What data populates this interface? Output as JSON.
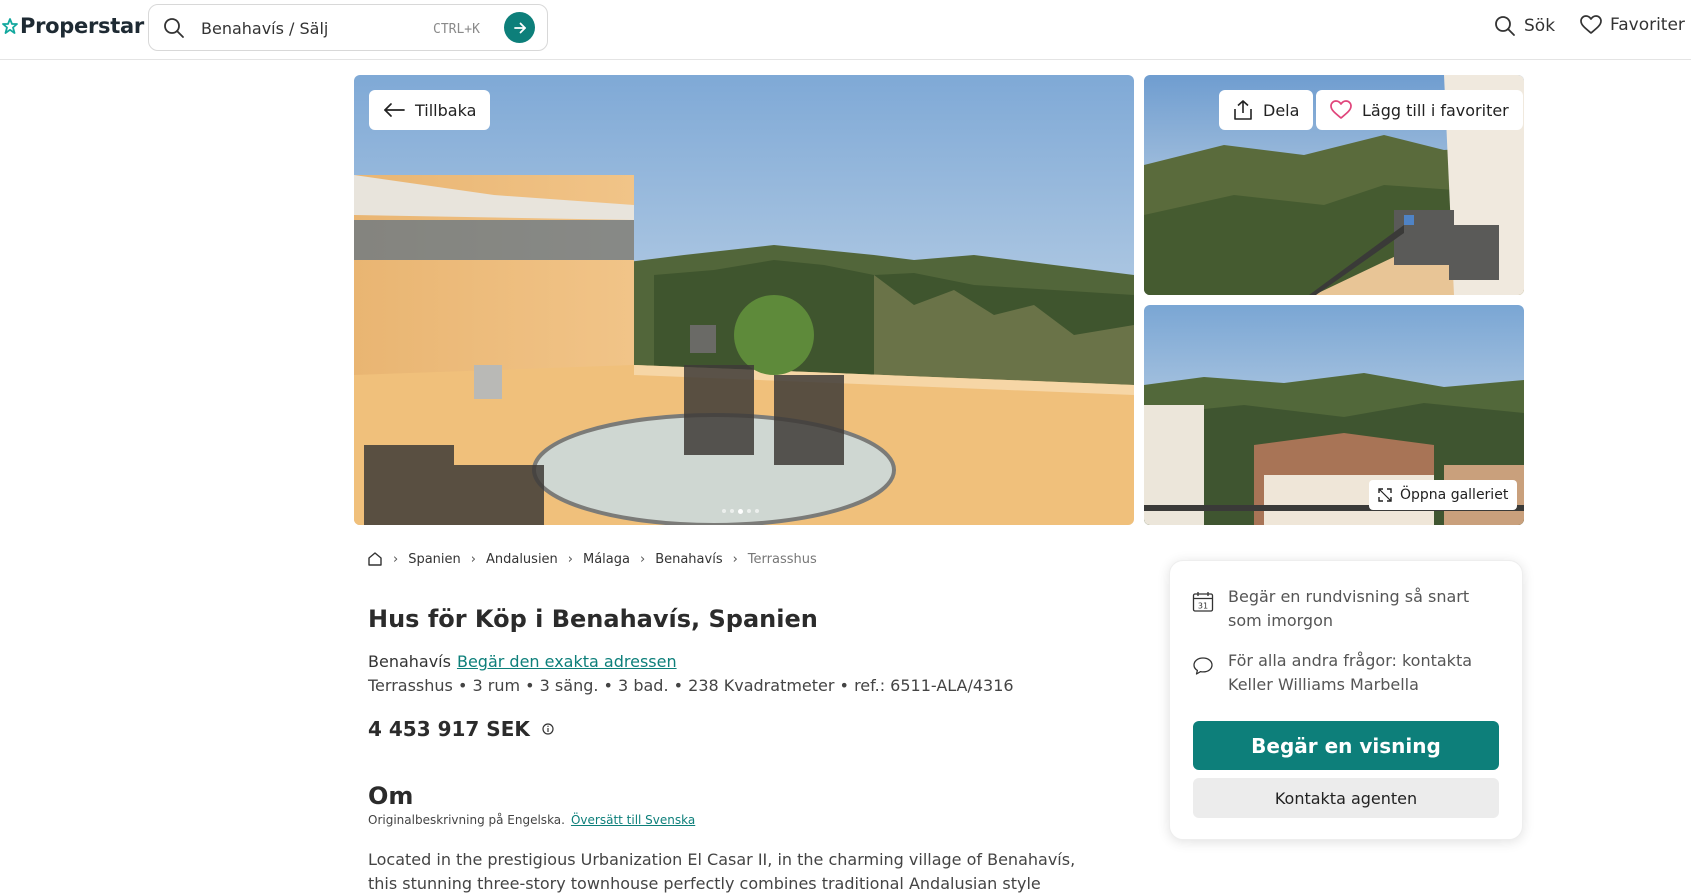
{
  "header": {
    "logo_text": "Properstar",
    "search_value": "Benahavís / Sälj",
    "search_shortcut": "CTRL+K",
    "nav_search_label": "Sök",
    "nav_favorites_label": "Favoriter"
  },
  "gallery": {
    "back_label": "Tillbaka",
    "share_label": "Dela",
    "favorite_label": "Lägg till i favoriter",
    "open_gallery_label": "Öppna galleriet",
    "dots_count": 5,
    "active_dot": 2
  },
  "breadcrumb": {
    "items": [
      "Spanien",
      "Andalusien",
      "Málaga",
      "Benahavís"
    ],
    "current": "Terrasshus"
  },
  "listing": {
    "title": "Hus för Köp i Benahavís, Spanien",
    "location": "Benahavís",
    "address_link": "Begär den exakta adressen",
    "facts": "Terrasshus • 3 rum • 3 säng. • 3 bad. • 238 Kvadratmeter • ref.: 6511-ALA/4316",
    "price": "4 453 917 SEK"
  },
  "about": {
    "heading": "Om",
    "original_note": "Originalbeskrivning på Engelska.",
    "translate_link": "Översätt till Svenska",
    "description": "Located in the prestigious Urbanization El Casar II, in the charming village of Benahavís, this stunning three-story townhouse perfectly combines traditional Andalusian style with modern"
  },
  "contact_card": {
    "tour_text": "Begär en rundvisning så snart som imorgon",
    "calendar_day": "31",
    "questions_text": "För alla andra frågor: kontakta Keller Williams Marbella",
    "request_button": "Begär en visning",
    "contact_button": "Kontakta agenten"
  },
  "colors": {
    "accent": "#0d7f7a",
    "favorite_heart": "#e0457b"
  }
}
